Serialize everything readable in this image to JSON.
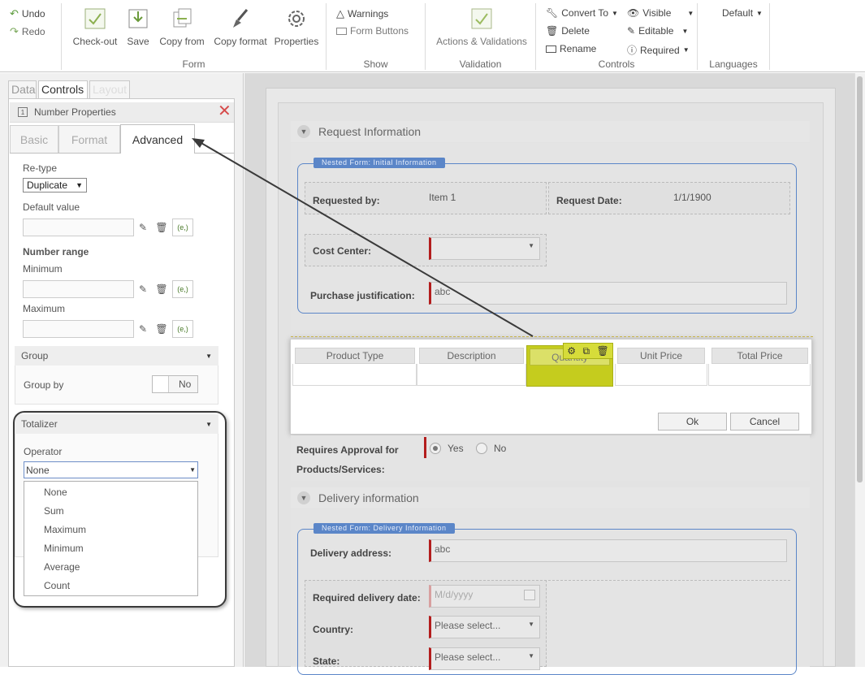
{
  "ribbon": {
    "undo": "Undo",
    "redo": "Redo",
    "form_group": {
      "label": "Form",
      "buttons": [
        "Check-out",
        "Save",
        "Copy from",
        "Copy format",
        "Properties"
      ]
    },
    "show_group": {
      "label": "Show",
      "warnings": "Warnings",
      "form_buttons": "Form Buttons"
    },
    "validation_group": {
      "label": "Validation",
      "button": "Actions & Validations"
    },
    "controls_group": {
      "label": "Controls",
      "convert_to": "Convert To",
      "delete": "Delete",
      "rename": "Rename",
      "visible": "Visible",
      "editable": "Editable",
      "required": "Required"
    },
    "languages_group": {
      "label": "Languages",
      "default": "Default"
    }
  },
  "left_panel": {
    "tabs": [
      "Data",
      "Controls",
      "Layout"
    ],
    "active_tab": "Controls",
    "properties_title": "Number Properties",
    "subtabs": [
      "Basic",
      "Format",
      "Advanced"
    ],
    "active_subtab": "Advanced",
    "retype_label": "Re-type",
    "retype_value": "Duplicate",
    "default_value_label": "Default value",
    "number_range_label": "Number range",
    "minimum_label": "Minimum",
    "maximum_label": "Maximum",
    "expr_icon": "(e,)",
    "group_section": "Group",
    "group_by_label": "Group by",
    "group_by_toggle": "No",
    "totalizer_section": "Totalizer",
    "operator_label": "Operator",
    "operator_value": "None",
    "operator_options": [
      "None",
      "Sum",
      "Maximum",
      "Minimum",
      "Average",
      "Count"
    ]
  },
  "form": {
    "request_section": "Request Information",
    "nested_initial": "Nested Form: Initial Information",
    "requested_by_label": "Requested by:",
    "requested_by_value": "Item 1",
    "request_date_label": "Request Date:",
    "request_date_value": "1/1/1900",
    "cost_center_label": "Cost Center:",
    "purchase_label": "Purchase justification:",
    "purchase_value": "abc",
    "grid_columns": [
      "Product Type",
      "Description",
      "Quantity",
      "Unit Price",
      "Total Price"
    ],
    "ok_button": "Ok",
    "cancel_button": "Cancel",
    "approval_label_line1": "Requires Approval for",
    "approval_label_line2": "Products/Services:",
    "approval_yes": "Yes",
    "approval_no": "No",
    "delivery_section": "Delivery information",
    "nested_delivery": "Nested Form: Delivery Information",
    "delivery_address_label": "Delivery address:",
    "delivery_address_value": "abc",
    "delivery_date_label": "Required delivery date:",
    "delivery_date_placeholder": "M/d/yyyy",
    "country_label": "Country:",
    "country_value": "Please select...",
    "state_label": "State:",
    "state_value": "Please select..."
  },
  "colors": {
    "nested_border": "#5b86c8",
    "required_marker": "#b31d1d",
    "selected_column": "#c5cc1e"
  }
}
